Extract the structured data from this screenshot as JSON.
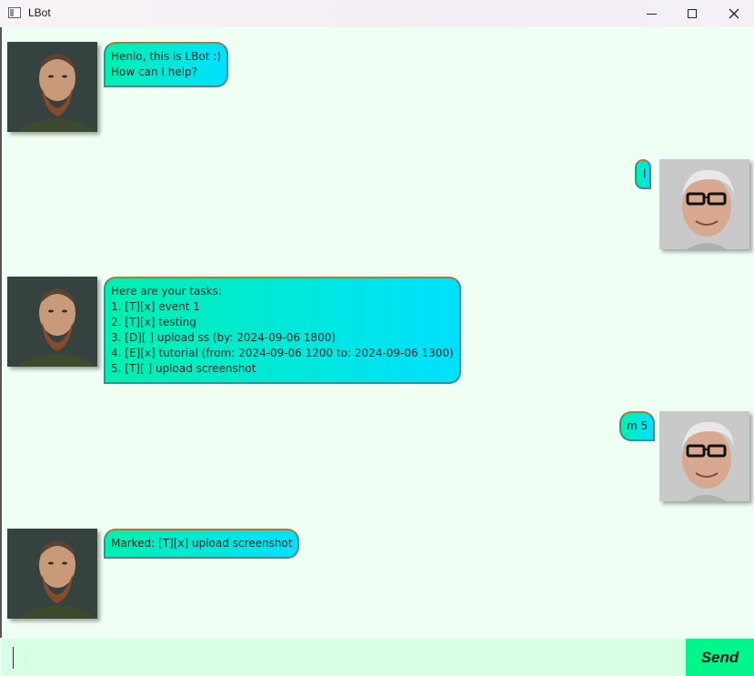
{
  "window": {
    "title": "LBot"
  },
  "messages": [
    {
      "sender": "bot",
      "text": "Henlo, this is LBot :)\nHow can I help?"
    },
    {
      "sender": "user",
      "text": "l"
    },
    {
      "sender": "bot",
      "text": "Here are your tasks:\n1. [T][x] event 1\n2. [T][x] testing\n3. [D][ ] upload ss (by: 2024-09-06 1800)\n4. [E][x] tutorial (from: 2024-09-06 1200 to: 2024-09-06 1300)\n5. [T][ ] upload screenshot"
    },
    {
      "sender": "user",
      "text": "m 5"
    },
    {
      "sender": "bot",
      "text": "Marked: [T][x] upload screenshot"
    }
  ],
  "input": {
    "value": "",
    "send_label": "Send"
  },
  "colors": {
    "chat_background": "#f0fff4",
    "bubble_gradient_start": "#00f0b0",
    "bubble_gradient_end": "#00e0ff",
    "send_button": "#00f58a",
    "input_background": "#d6ffe6"
  }
}
